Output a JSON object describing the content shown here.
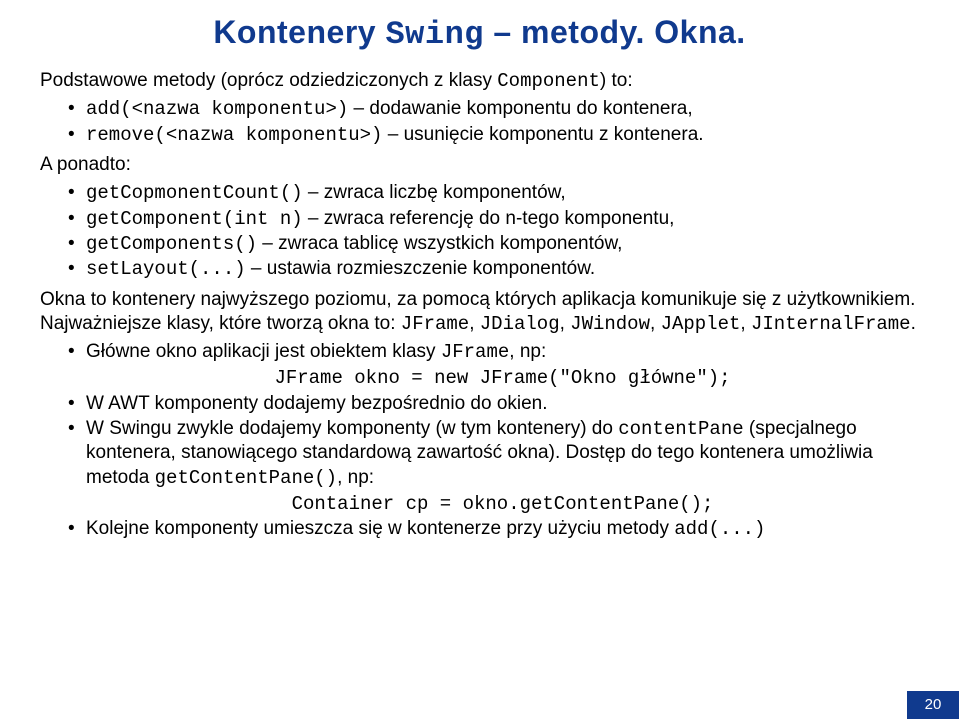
{
  "title": {
    "part1": "Kontenery ",
    "code": "Swing",
    "part2": " – metody. Okna."
  },
  "intro": {
    "text1": "Podstawowe metody (oprócz odziedziczonych z klasy ",
    "code1": "Component",
    "text2": ") to:"
  },
  "methods1": [
    {
      "code": "add(<nazwa komponentu>)",
      "desc": " – dodawanie komponentu do kontenera,"
    },
    {
      "code": "remove(<nazwa komponentu>)",
      "desc": " – usunięcie komponentu z kontenera."
    }
  ],
  "aponadto": "A ponadto:",
  "methods2": [
    {
      "code": "getCopmonentCount()",
      "desc": " – zwraca liczbę komponentów,"
    },
    {
      "code": "getComponent(int n)",
      "desc": " – zwraca referencję do n-tego komponentu,"
    },
    {
      "code": "getComponents()",
      "desc": " – zwraca tablicę wszystkich komponentów,"
    },
    {
      "code": "setLayout(...)",
      "desc": " – ustawia rozmieszczenie komponentów."
    }
  ],
  "para1": {
    "t1": "Okna to kontenery najwyższego poziomu, za pomocą których aplikacja komunikuje się z użytkownikiem. Najważniejsze klasy, które tworzą okna to: ",
    "c1": "JFrame",
    "t2": ", ",
    "c2": "JDialog",
    "t3": ", ",
    "c3": "JWindow",
    "t4": ", ",
    "c4": "JApplet",
    "t5": ", ",
    "c5": "JInternalFrame",
    "t6": "."
  },
  "bullets3": {
    "b1": {
      "t1": "Główne okno aplikacji jest obiektem klasy ",
      "c1": "JFrame",
      "t2": ", np:"
    },
    "code_line": "JFrame okno = new JFrame(\"Okno główne\");",
    "b2": "W AWT komponenty dodajemy bezpośrednio do okien.",
    "b3": {
      "t1": "W Swingu zwykle dodajemy komponenty (w tym kontenery) do ",
      "c1": "contentPane",
      "t2": " (specjalnego kontenera, stanowiącego standardową zawartość okna). Dostęp do tego kontenera umożliwia metoda ",
      "c2": "getContentPane()",
      "t3": ", np:"
    },
    "code_line2": "Container cp = okno.getContentPane();",
    "b4": {
      "t1": "Kolejne komponenty umieszcza się w kontenerze przy użyciu metody ",
      "c1": "add(...)"
    }
  },
  "page_number": "20"
}
